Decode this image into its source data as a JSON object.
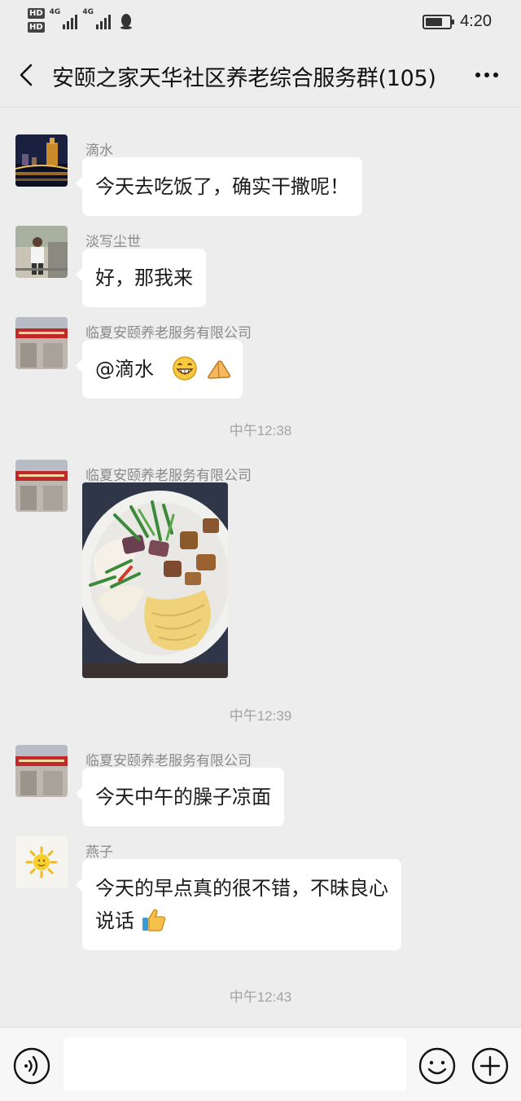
{
  "status_bar": {
    "hd_1": "HD",
    "hd_2": "HD",
    "network_1": "4G",
    "network_2": "4G",
    "time": "4:20",
    "battery_level": 0.7
  },
  "header": {
    "title": "安颐之家天华社区养老综合服务群(105)",
    "back_icon": "chevron-left-icon",
    "more_icon": "more-dots-icon"
  },
  "messages": [
    {
      "sender": "滴水",
      "text": "今天去吃饭了，确实干撒呢！",
      "avatar": "night-city-avatar"
    },
    {
      "sender": "淡写尘世",
      "text": "好，那我来",
      "avatar": "person-avatar"
    },
    {
      "sender": "临夏安颐养老服务有限公司",
      "text": "@滴水",
      "avatar": "storefront-avatar",
      "emojis": [
        "grin-emoji",
        "clap-emoji"
      ]
    }
  ],
  "timestamps": [
    "中午12:38",
    "中午12:39",
    "中午12:43"
  ],
  "messages_2": [
    {
      "sender": "临夏安颐养老服务有限公司",
      "type": "image",
      "image": "noodle-dish-photo"
    },
    {
      "sender": "临夏安颐养老服务有限公司",
      "text": "今天中午的臊子凉面"
    },
    {
      "sender": "燕子",
      "text_line_1": "今天的早点真的很不错，不昧良心",
      "text_line_2": "说话",
      "avatar": "sun-avatar",
      "emoji": "thumbs-up-emoji"
    }
  ],
  "input_bar": {
    "voice_icon": "voice-icon",
    "emoji_icon": "emoji-icon",
    "plus_icon": "plus-icon",
    "input_value": ""
  },
  "colors": {
    "background": "#ededed",
    "bubble": "#ffffff",
    "timestamp": "#a3a3a3",
    "sender": "#8a8a8a"
  }
}
